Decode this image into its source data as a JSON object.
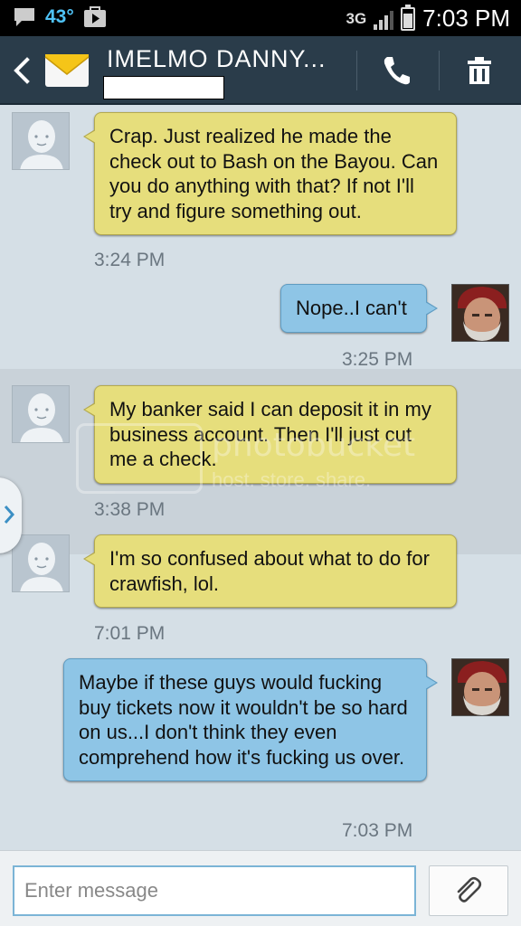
{
  "status_bar": {
    "temperature": "43°",
    "network": "3G",
    "time": "7:03 PM",
    "icons": [
      "chat-notification-icon",
      "play-store-icon",
      "signal-icon",
      "battery-icon"
    ]
  },
  "header": {
    "contact_name": "IMELMO DANNY...",
    "icons": [
      "back-icon",
      "message-envelope-icon",
      "phone-icon",
      "trash-icon"
    ]
  },
  "messages": [
    {
      "direction": "incoming",
      "text": "Crap.  Just realized he made the check out to Bash on the Bayou.  Can you do anything with that?  If not I'll try and figure something out.",
      "time": "3:24 PM"
    },
    {
      "direction": "outgoing",
      "text": "Nope..I can't",
      "time": "3:25 PM"
    },
    {
      "direction": "incoming",
      "text": "My banker said I can deposit it in my business account.  Then I'll just cut me a check.",
      "time": "3:38 PM"
    },
    {
      "direction": "incoming",
      "text": "I'm so confused about what to do for crawfish, lol.",
      "time": "7:01 PM"
    },
    {
      "direction": "outgoing",
      "text": "Maybe if these guys would fucking buy tickets now it wouldn't be so hard on us...I don't think they even comprehend how it's fucking us over.",
      "time": "7:03 PM"
    }
  ],
  "watermark": {
    "brand": "photobucket",
    "tagline": "host. store. share."
  },
  "input": {
    "placeholder": "Enter message",
    "value": ""
  },
  "colors": {
    "incoming_bubble": "#e6de7c",
    "outgoing_bubble": "#8ec5e6",
    "header_bg": "#2a3c4a",
    "conversation_bg": "#d5dfe6"
  }
}
